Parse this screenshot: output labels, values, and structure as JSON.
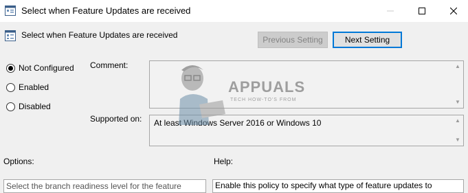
{
  "window": {
    "title": "Select when Feature Updates are received",
    "icons": [
      "policy-icon",
      "minimize-icon",
      "maximize-icon",
      "close-icon"
    ]
  },
  "header": {
    "policy_title": "Select when Feature Updates are received",
    "previous_label": "Previous Setting",
    "next_label": "Next Setting"
  },
  "state": {
    "options": [
      {
        "label": "Not Configured",
        "checked": true
      },
      {
        "label": "Enabled",
        "checked": false
      },
      {
        "label": "Disabled",
        "checked": false
      }
    ]
  },
  "comment": {
    "label": "Comment:",
    "value": ""
  },
  "supported": {
    "label": "Supported on:",
    "value": "At least Windows Server 2016 or Windows 10"
  },
  "options_section": {
    "label": "Options:",
    "partial_text": "Select the branch readiness level for the feature"
  },
  "help_section": {
    "label": "Help:",
    "partial_text": "Enable this policy to specify what type of feature updates to"
  },
  "watermark": {
    "brand": "APPUALS",
    "tagline": "TECH HOW-TO'S FROM"
  },
  "colors": {
    "accent": "#0078d7",
    "background": "#f0f0f0",
    "disabled_text": "#838383"
  }
}
